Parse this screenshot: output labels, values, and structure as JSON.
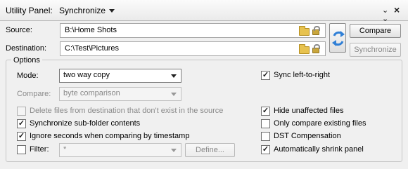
{
  "titlebar": {
    "panel_label": "Utility Panel:",
    "panel_name": "Synchronize",
    "collapse_icon": "double-chevron-down-icon",
    "close_icon": "close-icon"
  },
  "source": {
    "label": "Source:",
    "value": "B:\\Home Shots"
  },
  "destination": {
    "label": "Destination:",
    "value": "C:\\Test\\Pictures"
  },
  "buttons": {
    "compare": "Compare",
    "synchronize": "Synchronize",
    "define": "Define..."
  },
  "options": {
    "title": "Options",
    "mode_label": "Mode:",
    "mode_value": "two way copy",
    "compare_label": "Compare:",
    "compare_value": "byte comparison",
    "filter_label": "Filter:",
    "filter_value": "*"
  },
  "checkboxes": {
    "delete_files": {
      "label": "Delete files from destination that don't exist in the source",
      "checked": false,
      "enabled": false
    },
    "sync_subfolders": {
      "label": "Synchronize sub-folder contents",
      "checked": true,
      "enabled": true
    },
    "ignore_seconds": {
      "label": "Ignore seconds when comparing by timestamp",
      "checked": true,
      "enabled": true
    },
    "filter": {
      "checked": false,
      "enabled": true
    },
    "sync_left_right": {
      "label": "Sync left-to-right",
      "checked": true,
      "enabled": true
    },
    "hide_unaffected": {
      "label": "Hide unaffected files",
      "checked": true,
      "enabled": true
    },
    "only_compare_existing": {
      "label": "Only compare existing files",
      "checked": false,
      "enabled": true
    },
    "dst_compensation": {
      "label": "DST Compensation",
      "checked": false,
      "enabled": true
    },
    "auto_shrink": {
      "label": "Automatically shrink panel",
      "checked": true,
      "enabled": true
    }
  },
  "colors": {
    "swap_arrow": "#2f7fd6",
    "folder": "#e7c24f"
  }
}
